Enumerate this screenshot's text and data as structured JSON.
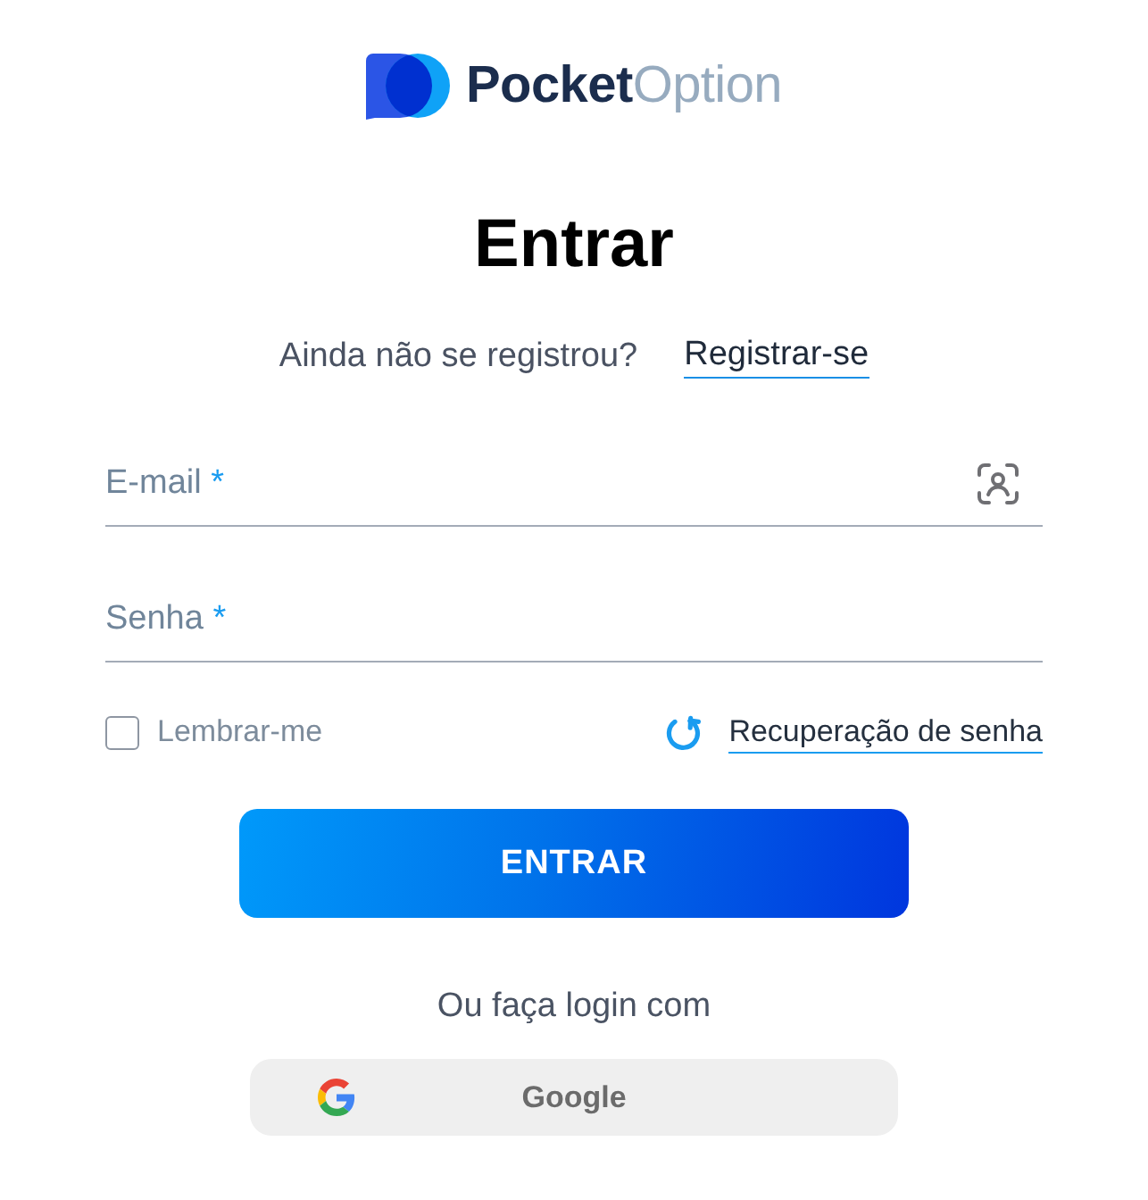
{
  "logo": {
    "text": "**Pocket**Option"
  },
  "title": "Entrar",
  "signup_prompt": {
    "text": "Ainda não se registrou?",
    "link": "Registrar-se"
  },
  "fields": [
    {
      "kind": "email",
      "label": "E-mail",
      "required_mark": "*"
    },
    {
      "kind": "password",
      "label": "Senha",
      "required_mark": "*"
    }
  ],
  "remember_me": {
    "label": "Lembrar-me",
    "checked": false
  },
  "recovery_link": "Recuperação de senha",
  "submit_button": "ENTRAR",
  "alt_login": {
    "text": "Ou faça login com",
    "buttons": [
      {
        "kind": "google",
        "label": "Google"
      }
    ]
  }
}
